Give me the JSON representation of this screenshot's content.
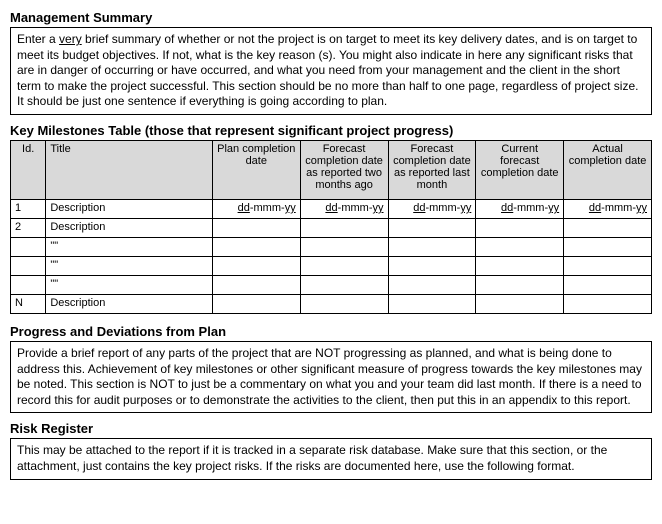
{
  "sections": {
    "mgmt": {
      "title": "Management Summary",
      "text_pre": "Enter a ",
      "text_underlined": "very",
      "text_post": " brief summary of whether or not the project is on target to meet its key delivery dates, and is on target to meet its budget objectives.   If not, what is the key reason (s).  You might also indicate in here any significant risks that are in danger of occurring or have occurred, and what you need from your management and the client in the short term to make the project successful.  This section should be no more than half to one page, regardless of project size.  It should be just one sentence if everything is going according to plan."
    },
    "milestones": {
      "title": "Key Milestones Table (those that represent significant project progress)",
      "headers": {
        "id": "Id.",
        "title": "Title",
        "plan": "Plan completion date",
        "f2": "Forecast completion date as reported two months ago",
        "f1": "Forecast completion date as reported last month",
        "cf": "Current forecast completion date",
        "actual": "Actual completion date"
      },
      "date_parts": {
        "dd": "dd",
        "sep": "-",
        "mmm": "mmm",
        "yy": "yy"
      },
      "rows": [
        {
          "id": "1",
          "title": "Description",
          "dates": true
        },
        {
          "id": "2",
          "title": "Description",
          "dates": false
        },
        {
          "id": "",
          "title": "\"\"",
          "dates": false
        },
        {
          "id": "",
          "title": "\"\"",
          "dates": false
        },
        {
          "id": "",
          "title": "\"\"",
          "dates": false
        },
        {
          "id": "N",
          "title": "Description",
          "dates": false
        }
      ]
    },
    "progress": {
      "title": "Progress and Deviations from Plan",
      "text": "Provide a brief report of any parts of the project that are NOT progressing as planned, and what is being done to address this.  Achievement of key milestones or other significant measure of progress towards the key milestones may be noted.  This section is NOT to just be a commentary on what you and your team did last month.  If there is a need to record this for audit purposes or to demonstrate the activities to the client, then put this in an appendix to this report."
    },
    "risk": {
      "title": "Risk Register",
      "text": "This may be attached to the report if it is tracked in a separate risk database.  Make sure that this section, or the attachment, just contains the key project risks.  If the risks are documented here, use the following format."
    }
  }
}
